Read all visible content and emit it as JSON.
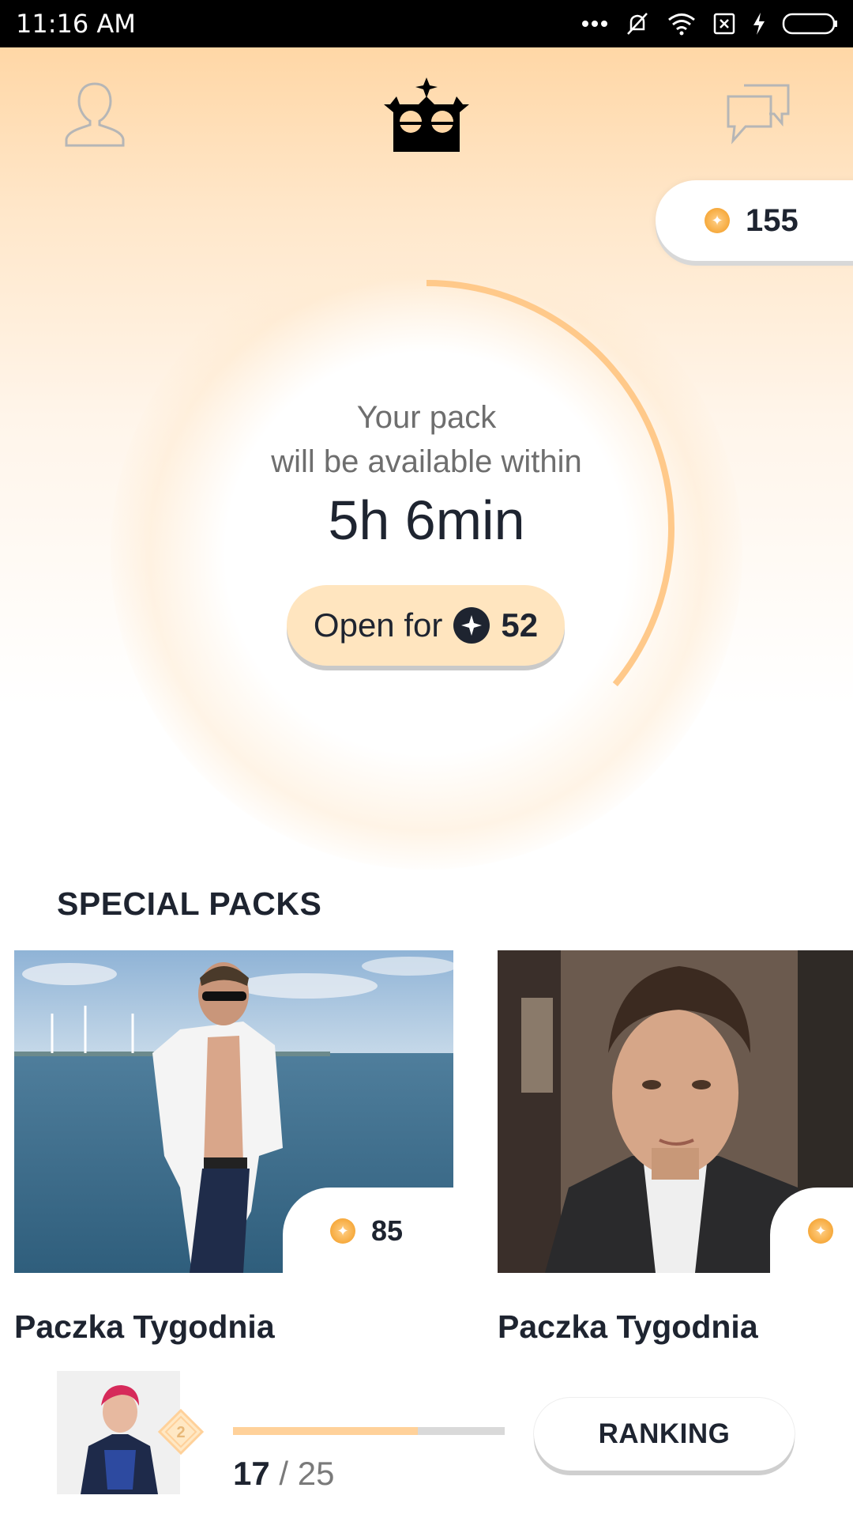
{
  "status_bar": {
    "time": "11:16 AM"
  },
  "header": {
    "profile_icon": "person-outline-icon",
    "logo_icon": "crown-icon",
    "chat_icon": "chat-bubbles-icon"
  },
  "coins": {
    "balance": "155"
  },
  "timer": {
    "line1": "Your pack",
    "line2": "will be available within",
    "remaining": "5h 6min",
    "progress_fraction": 0.36
  },
  "open_button": {
    "label": "Open for",
    "price": "52"
  },
  "special_packs": {
    "title": "SPECIAL PACKS",
    "items": [
      {
        "name": "Paczka Tygodnia",
        "price": "85"
      },
      {
        "name": "Paczka Tygodnia",
        "price": ""
      }
    ]
  },
  "ranking": {
    "level": "2",
    "current": "17",
    "separator": "/",
    "total": "25",
    "progress_fraction": 0.68,
    "button_label": "RANKING"
  },
  "colors": {
    "accent": "#ffc98a",
    "coin": "#f6a93c",
    "text_dark": "#1e2430"
  }
}
